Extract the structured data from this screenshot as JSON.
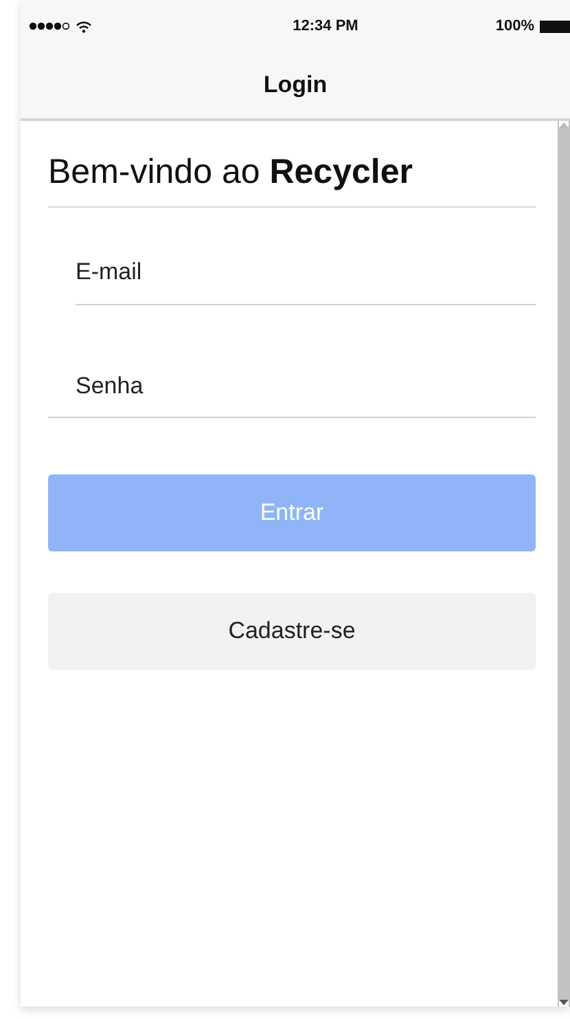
{
  "status_bar": {
    "time": "12:34 PM",
    "battery": "100%"
  },
  "nav_bar": {
    "title": "Login"
  },
  "heading": "Bem-vindo ao **Recycler**",
  "fields": [
    {
      "placeholder": "E-mail",
      "kind": "inset"
    },
    {
      "placeholder": "Senha",
      "kind": "full"
    }
  ],
  "buttons": [
    {
      "label": "Entrar",
      "kind": "primary",
      "disabled": true
    },
    {
      "label": "Cadastre-se",
      "kind": "secondary",
      "disabled": false
    }
  ]
}
